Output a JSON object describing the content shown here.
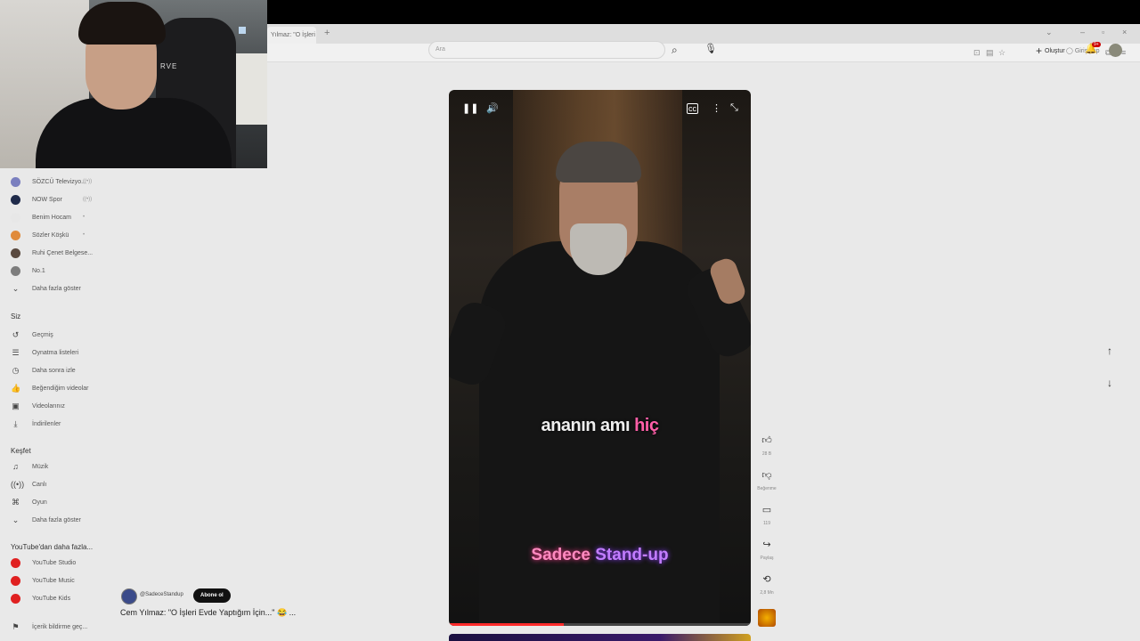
{
  "browser": {
    "tab_title": "Yılmaz: \"O İşleri",
    "new_tab": "+",
    "signin_label": "Giriş yap"
  },
  "header": {
    "search_placeholder": "Ara",
    "create_label": "Oluştur",
    "notification_badge": "9+"
  },
  "sidebar": {
    "subscriptions": [
      {
        "label": "SÖZCÜ Televizyo...",
        "live": "((•))",
        "color": "#7a7fbf"
      },
      {
        "label": "NOW Spor",
        "live": "((•))",
        "color": "#1f2a4a"
      },
      {
        "label": "Benim Hocam",
        "live": "•",
        "color": "#e7e7e7"
      },
      {
        "label": "Sözler Köşkü",
        "live": "•",
        "color": "#e08a3a"
      },
      {
        "label": "Ruhi Çenet Belgese...",
        "live": "",
        "color": "#5a4a40"
      },
      {
        "label": "No.1",
        "live": "",
        "color": "#7d7d7d"
      }
    ],
    "show_more_1": "Daha fazla göster",
    "you_heading": "Siz",
    "you_items": [
      {
        "label": "Geçmiş",
        "icon": "history-icon",
        "glyph": "↺"
      },
      {
        "label": "Oynatma listeleri",
        "icon": "playlist-icon",
        "glyph": "☰"
      },
      {
        "label": "Daha sonra izle",
        "icon": "clock-icon",
        "glyph": "◷"
      },
      {
        "label": "Beğendiğim videolar",
        "icon": "like-icon",
        "glyph": "👍"
      },
      {
        "label": "Videolarınız",
        "icon": "video-icon",
        "glyph": "▣"
      },
      {
        "label": "İndirilenler",
        "icon": "download-icon",
        "glyph": "⤓"
      }
    ],
    "explore_heading": "Keşfet",
    "explore_items": [
      {
        "label": "Müzik",
        "icon": "music-icon",
        "glyph": "♫"
      },
      {
        "label": "Canlı",
        "icon": "live-icon",
        "glyph": "((•))"
      },
      {
        "label": "Oyun",
        "icon": "gaming-icon",
        "glyph": "⌘"
      }
    ],
    "show_more_2": "Daha fazla göster",
    "more_yt_heading": "YouTube'dan daha fazla...",
    "more_yt_items": [
      {
        "label": "YouTube Studio",
        "color": "#e02020"
      },
      {
        "label": "YouTube Music",
        "color": "#e02020"
      },
      {
        "label": "YouTube Kids",
        "color": "#e02020"
      }
    ],
    "report_label": "İçerik bildirme geç..."
  },
  "video": {
    "caption_plain": "ananın amı ",
    "caption_highlight": "hiç",
    "watermark_a": "Sadece ",
    "watermark_b": "Stand-up",
    "progress": 0.38
  },
  "actions": {
    "like_count": "28 B",
    "dislike_label": "Beğenme",
    "comment_count": "119",
    "share_label": "Paylaş",
    "remix_label": "2,8 Mn"
  },
  "channel": {
    "handle": "@SadeceStandup",
    "subscribe_label": "Abone ol",
    "video_title": "Cem Yılmaz: \"O İşleri Evde Yaptığım İçin...\" 😂 ..."
  },
  "webcam": {
    "chair_text": "RVE"
  }
}
